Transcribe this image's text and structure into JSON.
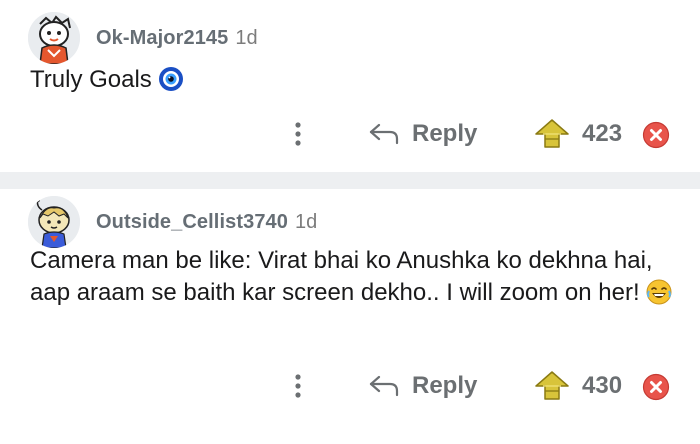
{
  "comments": [
    {
      "username": "Ok-Major2145",
      "age": "1d",
      "text": "Truly Goals",
      "inline_emoji": "nazar-amulet-icon",
      "reply_label": "Reply",
      "score": "423"
    },
    {
      "username": "Outside_Cellist3740",
      "age": "1d",
      "text": "Camera man be like: Virat bhai ko Anushka ko dekhna hai, aap araam se baith kar screen dekho.. I will zoom on her!",
      "inline_emoji": "laughing-face-icon",
      "reply_label": "Reply",
      "score": "430"
    }
  ],
  "icons": {
    "more": "vertical-dots-icon",
    "reply": "reply-arrow-icon",
    "upvote": "gold-arrow-up-icon",
    "downvote": "red-x-circle-icon"
  },
  "colors": {
    "username": "#666e75",
    "action_text": "#6b6f72",
    "divider": "#edeff1",
    "downvote": "#e8544b",
    "upvote": "#d8c43a"
  }
}
